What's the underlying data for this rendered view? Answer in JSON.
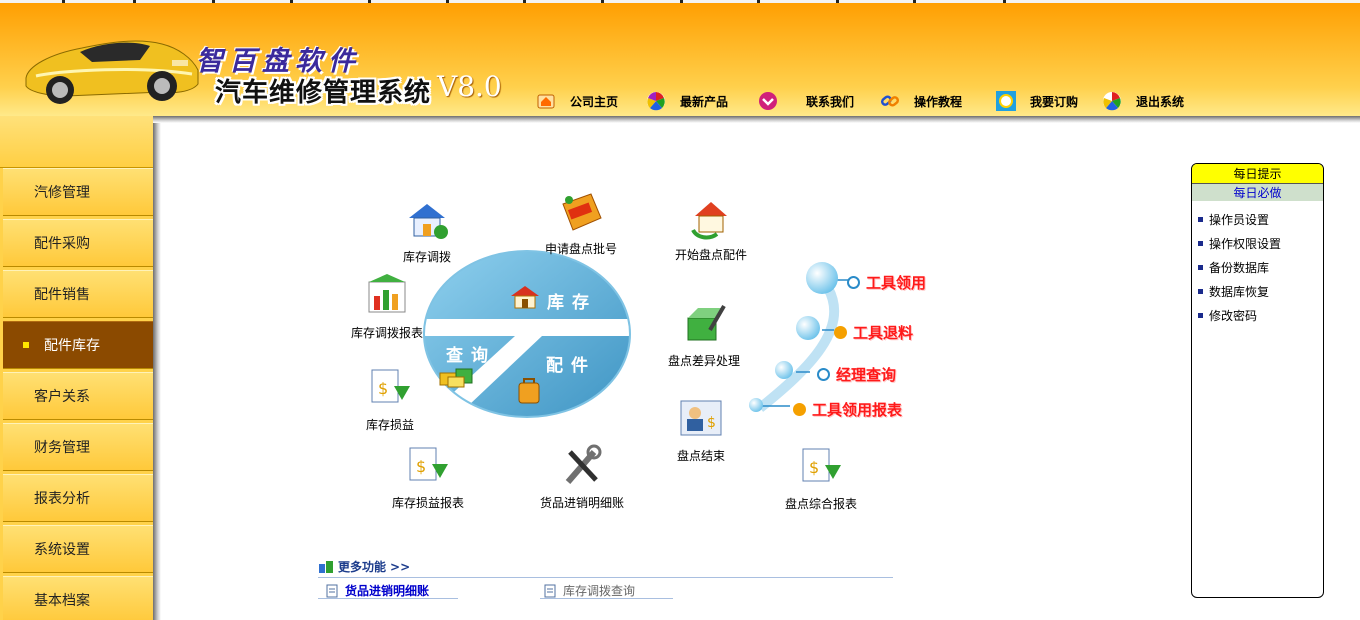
{
  "header": {
    "brand_line1": "智百盘软件",
    "brand_line2": "汽车维修管理系统",
    "version": "V8.0",
    "nav": [
      {
        "label": "公司主页",
        "icon": "home-icon"
      },
      {
        "label": "最新产品",
        "icon": "color-wheel-icon"
      },
      {
        "label": "联系我们",
        "icon": "contact-icon"
      },
      {
        "label": "操作教程",
        "icon": "link-icon"
      },
      {
        "label": "我要订购",
        "icon": "search-icon"
      },
      {
        "label": "退出系统",
        "icon": "exit-icon"
      }
    ]
  },
  "sidebar": {
    "active_index": 3,
    "items": [
      {
        "label": "汽修管理"
      },
      {
        "label": "配件采购"
      },
      {
        "label": "配件销售"
      },
      {
        "label": "配件库存"
      },
      {
        "label": "客户关系"
      },
      {
        "label": "财务管理"
      },
      {
        "label": "报表分析"
      },
      {
        "label": "系统设置"
      },
      {
        "label": "基本档案"
      }
    ]
  },
  "diagram": {
    "sections": {
      "stock": "库存",
      "query": "查询",
      "parts": "配件"
    },
    "functions": [
      {
        "label": "库存调拨",
        "icon": "house-transfer-icon"
      },
      {
        "label": "申请盘点批号",
        "icon": "tag-icon"
      },
      {
        "label": "开始盘点配件",
        "icon": "house-recycle-icon"
      },
      {
        "label": "库存调拨报表",
        "icon": "bar-chart-icon"
      },
      {
        "label": "盘点差异处理",
        "icon": "box-edit-icon"
      },
      {
        "label": "库存损益",
        "icon": "money-doc-icon"
      },
      {
        "label": "盘点结束",
        "icon": "user-card-icon"
      },
      {
        "label": "库存损益报表",
        "icon": "money-doc-icon"
      },
      {
        "label": "货品进销明细账",
        "icon": "tools-icon"
      },
      {
        "label": "盘点综合报表",
        "icon": "money-doc-icon"
      }
    ],
    "tools": [
      {
        "label": "工具领用"
      },
      {
        "label": "工具退料"
      },
      {
        "label": "经理查询"
      },
      {
        "label": "工具领用报表"
      }
    ]
  },
  "more": {
    "title": "更多功能",
    "arrows": ">>",
    "links": [
      {
        "label": "货品进销明细账",
        "color": "#0000cc"
      },
      {
        "label": "库存调拨查询",
        "color": "#666666"
      }
    ]
  },
  "tips": {
    "title": "每日提示",
    "subtitle": "每日必做",
    "items": [
      {
        "label": "操作员设置"
      },
      {
        "label": "操作权限设置"
      },
      {
        "label": "备份数据库"
      },
      {
        "label": "数据库恢复"
      },
      {
        "label": "修改密码"
      }
    ]
  },
  "colors": {
    "header_orange": "#ffa000",
    "sidebar_yellow": "#ffd24a",
    "sidebar_active": "#8b4a00",
    "pie_blue": "#5ab0d8",
    "tool_red": "#ff1a1a",
    "tips_yellow": "#ffff00"
  }
}
